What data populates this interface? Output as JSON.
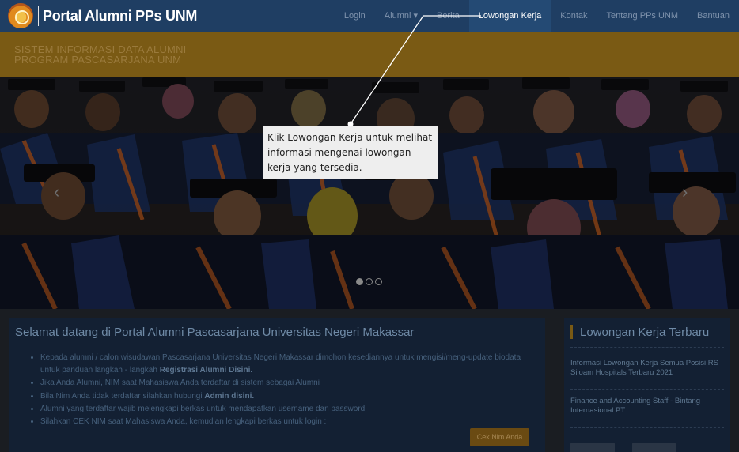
{
  "navbar": {
    "brand": "Portal Alumni PPs UNM",
    "items": [
      {
        "label": "Login"
      },
      {
        "label": "Alumni"
      },
      {
        "label": "Berita"
      },
      {
        "label": "Lowongan Kerja"
      },
      {
        "label": "Kontak"
      },
      {
        "label": "Tentang PPs UNM"
      },
      {
        "label": "Bantuan"
      }
    ],
    "active": "Lowongan Kerja"
  },
  "banner": {
    "line1": "SISTEM INFORMASI DATA ALUMNI",
    "line2": "PROGRAM PASCASARJANA UNM"
  },
  "carousel": {
    "prev_icon": "chevron-left-icon",
    "next_icon": "chevron-right-icon",
    "slides": 3,
    "active_slide": 1
  },
  "welcome": {
    "title": "Selamat datang di Portal Alumni Pascasarjana Universitas Negeri Makassar",
    "items": [
      {
        "text": "Kepada alumni / calon wisudawan Pascasarjana Universitas Negeri Makassar dimohon kesediannya untuk mengisi/meng-update biodata untuk panduan langkah - langkah ",
        "bold": "Registrasi Alumni Disini."
      },
      {
        "text": "Jika Anda Alumni, NIM saat Mahasiswa Anda terdaftar di sistem sebagai Alumni",
        "bold": ""
      },
      {
        "text": "Bila Nim Anda tidak terdaftar silahkan hubungi ",
        "bold": "Admin disini."
      },
      {
        "text": "Alumni yang terdaftar wajib melengkapi berkas untuk mendapatkan username dan password",
        "bold": ""
      },
      {
        "text": "Silahkan CEK NIM saat Mahasiswa Anda, kemudian lengkapi berkas untuk login :",
        "bold": ""
      }
    ],
    "button": "Cek Nim Anda"
  },
  "sidebar": {
    "title": "Lowongan Kerja Terbaru",
    "items": [
      {
        "title": "Informasi Lowongan Kerja Semua Posisi RS Siloam Hospitals Terbaru 2021"
      },
      {
        "title": "Finance and Accounting Staff - Bintang Internasional PT"
      }
    ]
  },
  "tooltip": {
    "text": "Klik Lowongan Kerja untuk melihat informasi mengenai lowongan kerja yang tersedia."
  },
  "colors": {
    "navbar": "#1f3e63",
    "active_nav": "#244a74",
    "banner": "#7a5a14",
    "panel": "#132033"
  }
}
